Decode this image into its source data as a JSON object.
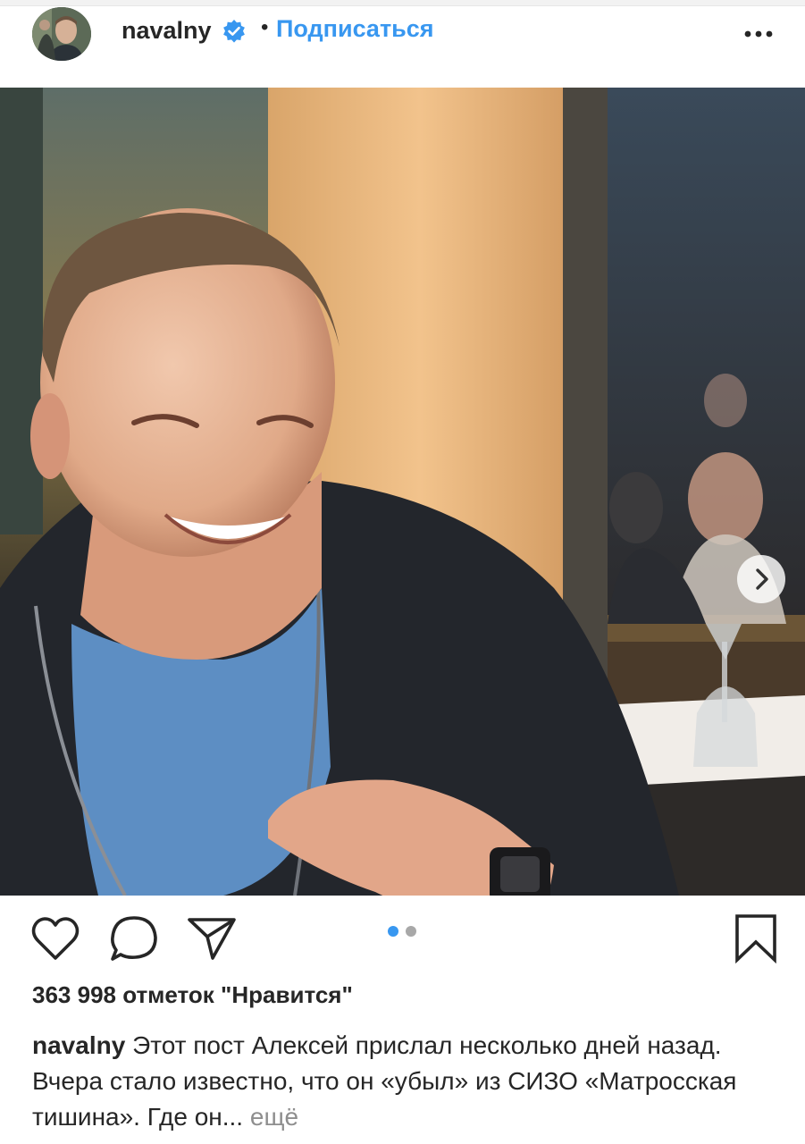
{
  "post": {
    "username": "navalny",
    "separator": "•",
    "follow_label": "Подписаться",
    "verified_icon": "verified-badge-icon",
    "more_icon": "more-options-icon",
    "photo_alt": "",
    "carousel": {
      "current": 1,
      "total": 2
    },
    "likes_text": "363 998 отметок \"Нравится\"",
    "caption_user": "navalny",
    "caption_text": "Этот пост Алексей прислал несколько дней назад. Вчера стало известно, что он «убыл» из СИЗО «Матросская тишина». Где он...",
    "caption_more": "ещё"
  },
  "colors": {
    "accent": "#3897f0",
    "text": "#262626",
    "muted": "#8e8e8e"
  },
  "icons": {
    "like": "heart-icon",
    "comment": "comment-bubble-icon",
    "share": "paper-plane-icon",
    "save": "bookmark-icon",
    "next": "chevron-right-icon"
  }
}
